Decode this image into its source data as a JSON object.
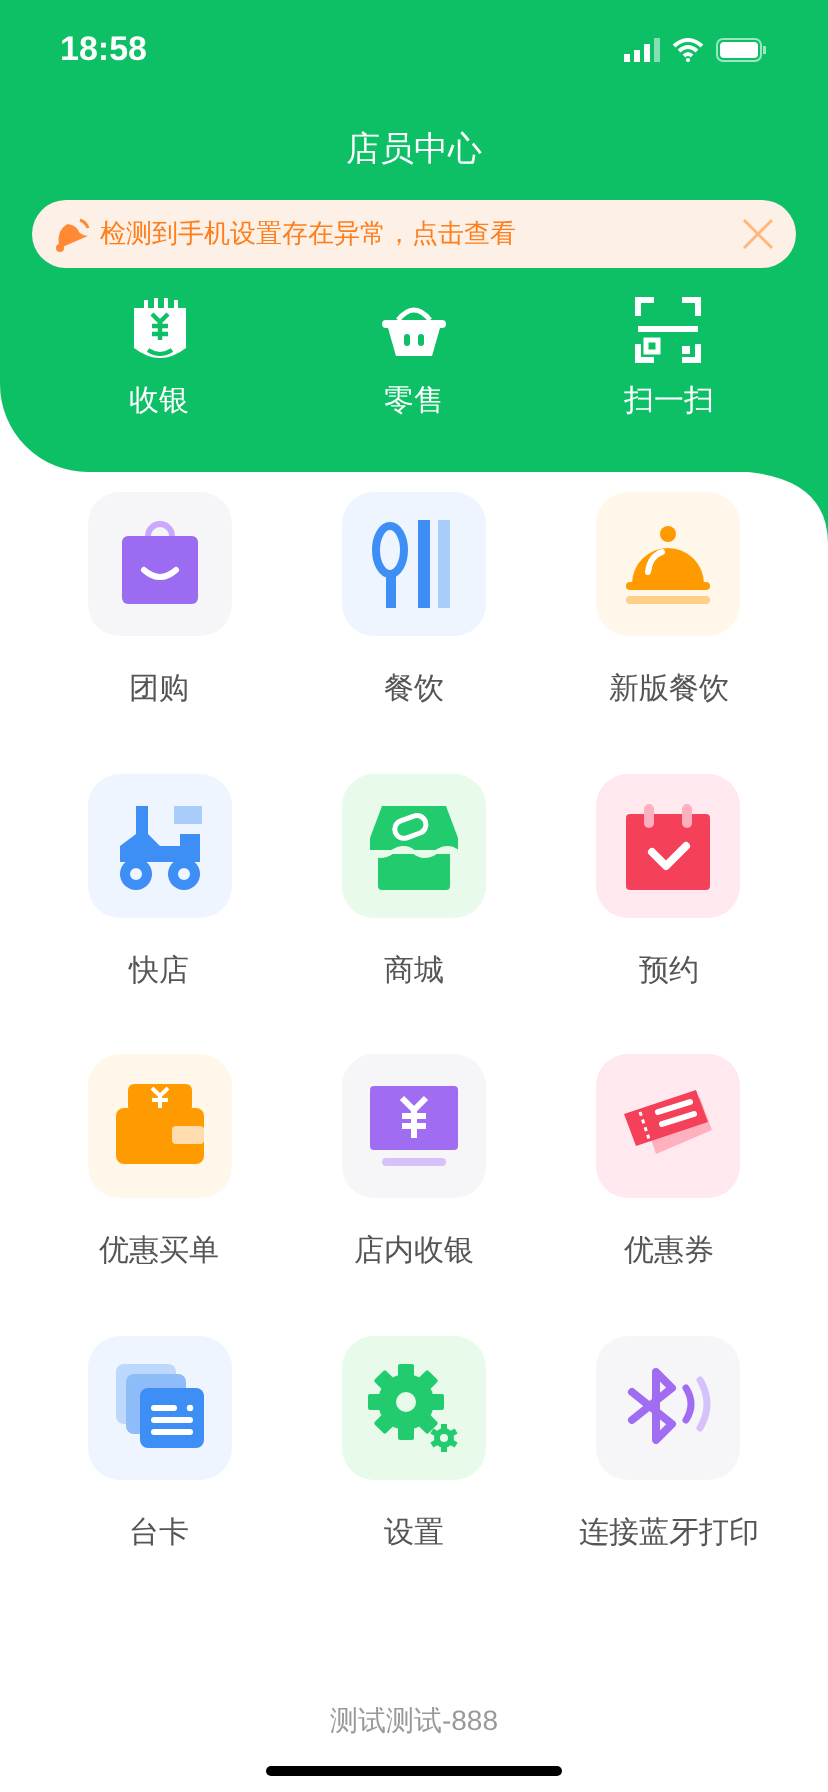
{
  "status_bar": {
    "time": "18:58"
  },
  "title": "店员中心",
  "notice": {
    "text": "检测到手机设置存在异常，点击查看"
  },
  "quick_actions": [
    {
      "label": "收银",
      "kind": "cashier"
    },
    {
      "label": "零售",
      "kind": "basket"
    },
    {
      "label": "扫一扫",
      "kind": "scan"
    }
  ],
  "features": [
    {
      "label": "团购",
      "kind": "bag"
    },
    {
      "label": "餐饮",
      "kind": "dining"
    },
    {
      "label": "新版餐饮",
      "kind": "cloche"
    },
    {
      "label": "快店",
      "kind": "scooter"
    },
    {
      "label": "商城",
      "kind": "shop"
    },
    {
      "label": "预约",
      "kind": "calendar"
    },
    {
      "label": "优惠买单",
      "kind": "wallet"
    },
    {
      "label": "店内收银",
      "kind": "register"
    },
    {
      "label": "优惠券",
      "kind": "ticket"
    },
    {
      "label": "台卡",
      "kind": "cards"
    },
    {
      "label": "设置",
      "kind": "gear"
    },
    {
      "label": "连接蓝牙打印",
      "kind": "bluetooth"
    }
  ],
  "footer": "测试测试-888"
}
